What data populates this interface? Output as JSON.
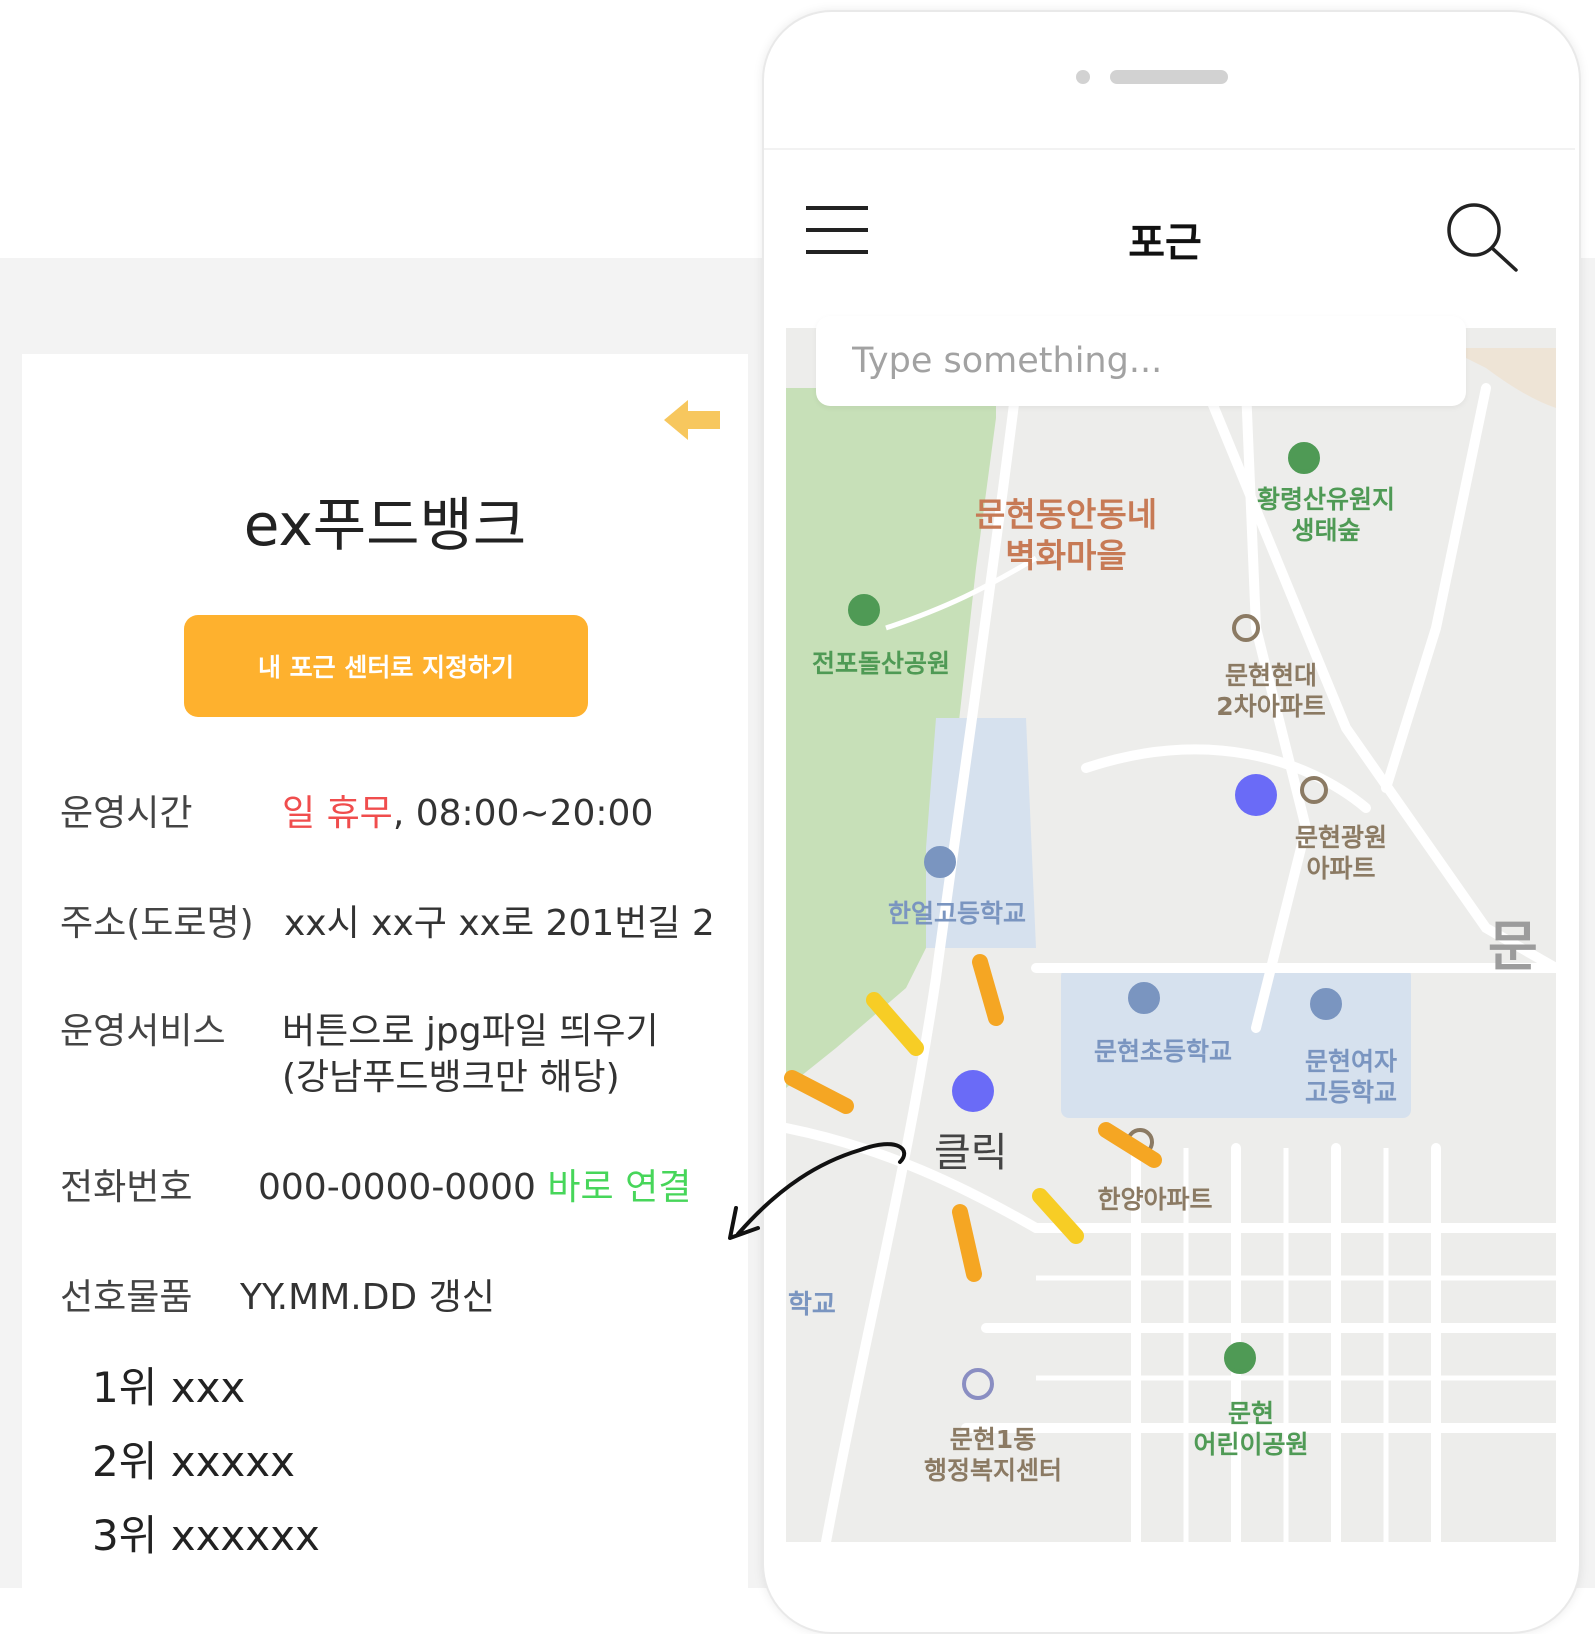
{
  "detail": {
    "title": "ex푸드뱅크",
    "set_center_button": "내 포근 센터로 지정하기",
    "hours_label": "운영시간",
    "hours_closed": "일 휴무",
    "hours_time": ", 08:00~20:00",
    "address_label": "주소(도로명)",
    "address_value": "xx시 xx구 xx로 201번길 2",
    "service_label": "운영서비스",
    "service_value_line1": "버튼으로 jpg파일 띄우기",
    "service_value_line2": "(강남푸드뱅크만 해당)",
    "phone_label": "전화번호",
    "phone_value": "000-0000-0000",
    "phone_link": "바로 연결",
    "preferred_label": "선호물품",
    "preferred_updated": "YY.MM.DD 갱신",
    "ranking": [
      "1위 xxx",
      "2위 xxxxx",
      "3위 xxxxxx"
    ]
  },
  "phone_app": {
    "title": "포근",
    "search_placeholder": "Type something...",
    "map_labels": {
      "mural_village": "문현동안동네\n벽화마을",
      "hwangnyeong": "황령산유원지\n생태숲",
      "jeonpo_park": "전포돌산공원",
      "munhyeon_hyundai": "문현현대\n2차아파트",
      "munhyeon_gwangwon": "문현광원\n아파트",
      "hanal_school": "한얼고등학교",
      "munhyeon_elementary": "문현초등학교",
      "munhyeon_girls": "문현여자\n고등학교",
      "hanyang_apt": "한양아파트",
      "munhyeon1_center": "문현1동\n행정복지센터",
      "munhyeon_kids_park": "문현\n어린이공원",
      "edge_mun": "문",
      "edge_school": "학교"
    },
    "click_hint": "클릭"
  },
  "colors": {
    "accent_button": "#feb12e",
    "closed_red": "#f04d4d",
    "link_green": "#47d65a",
    "pin_blue": "#6a6bf7",
    "back_arrow_yellow": "#f7c75e"
  }
}
